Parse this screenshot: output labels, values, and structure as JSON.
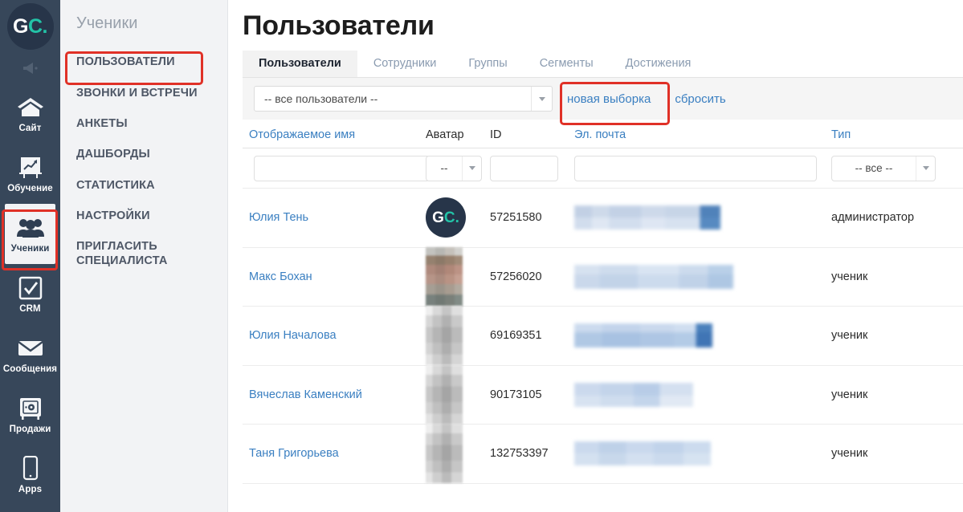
{
  "brand": {
    "logo_primary": "G",
    "logo_secondary": "C.",
    "color_dark": "#273549",
    "color_teal": "#23c3a7",
    "rail_bg": "#37475a",
    "accent_link": "#3a7fc1",
    "highlight": "#e03127"
  },
  "rail": {
    "items": [
      {
        "label": "Сайт",
        "icon": "home-icon",
        "active": false
      },
      {
        "label": "Обучение",
        "icon": "chart-board-icon",
        "active": false
      },
      {
        "label": "Ученики",
        "icon": "people-group-icon",
        "active": true
      },
      {
        "label": "CRM",
        "icon": "checkbox-icon",
        "active": false
      },
      {
        "label": "Сообщения",
        "icon": "envelope-icon",
        "active": false
      },
      {
        "label": "Продажи",
        "icon": "safe-icon",
        "active": false
      },
      {
        "label": "Apps",
        "icon": "phone-icon",
        "active": false
      }
    ]
  },
  "sidebar": {
    "title": "Ученики",
    "items": [
      {
        "label": "ПОЛЬЗОВАТЕЛИ",
        "highlighted": true
      },
      {
        "label": "ЗВОНКИ И ВСТРЕЧИ",
        "highlighted": false
      },
      {
        "label": "АНКЕТЫ",
        "highlighted": false
      },
      {
        "label": "ДАШБОРДЫ",
        "highlighted": false
      },
      {
        "label": "СТАТИСТИКА",
        "highlighted": false
      },
      {
        "label": "НАСТРОЙКИ",
        "highlighted": false
      },
      {
        "label": "ПРИГЛАСИТЬ СПЕЦИАЛИСТА",
        "highlighted": false
      }
    ]
  },
  "main": {
    "title": "Пользователи",
    "tabs": [
      {
        "label": "Пользователи",
        "active": true
      },
      {
        "label": "Сотрудники",
        "active": false
      },
      {
        "label": "Группы",
        "active": false
      },
      {
        "label": "Сегменты",
        "active": false
      },
      {
        "label": "Достижения",
        "active": false
      }
    ]
  },
  "filter_bar": {
    "selection_value": "-- все пользователи --",
    "new_selection_label": "новая выборка",
    "reset_label": "сбросить"
  },
  "table": {
    "headers": [
      {
        "label": "Отображаемое имя",
        "sortable": true
      },
      {
        "label": "Аватар",
        "sortable": false
      },
      {
        "label": "ID",
        "sortable": false
      },
      {
        "label": "Эл. почта",
        "sortable": true
      },
      {
        "label": "Тип",
        "sortable": true
      }
    ],
    "filters": {
      "name_value": "",
      "avatar_value": "--",
      "id_value": "",
      "email_value": "",
      "type_value": "-- все --"
    },
    "rows": [
      {
        "name": "Юлия Тень",
        "avatar_kind": "gc-logo",
        "id": "57251580",
        "email": "",
        "type": "администратор"
      },
      {
        "name": "Макс Бохан",
        "avatar_kind": "photo",
        "id": "57256020",
        "email": "",
        "type": "ученик"
      },
      {
        "name": "Юлия Началова",
        "avatar_kind": "photo",
        "id": "69169351",
        "email": "",
        "type": "ученик"
      },
      {
        "name": "Вячеслав Каменский",
        "avatar_kind": "photo",
        "id": "90173105",
        "email": "",
        "type": "ученик"
      },
      {
        "name": "Таня Григорьева",
        "avatar_kind": "photo",
        "id": "132753397",
        "email": "",
        "type": "ученик"
      }
    ]
  }
}
